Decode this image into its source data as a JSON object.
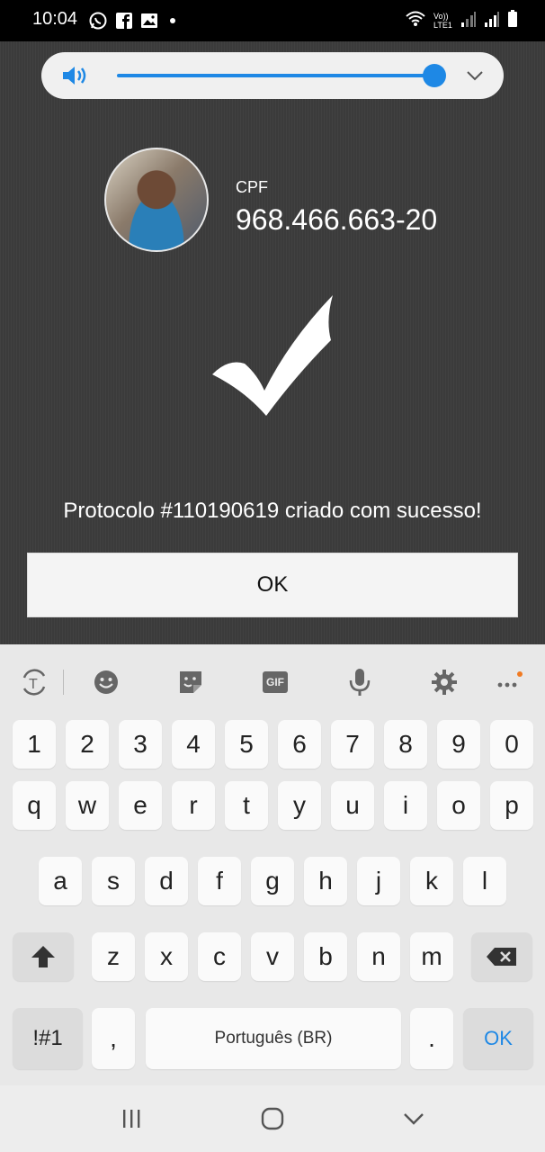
{
  "status_bar": {
    "time": "10:04",
    "icons": [
      "whatsapp-icon",
      "facebook-icon",
      "gallery-icon",
      "dot-icon",
      "wifi-icon",
      "volte-icon",
      "signal-icon",
      "signal-icon",
      "battery-icon"
    ],
    "network_label": "Vo)) LTE1"
  },
  "volume": {
    "level": 1.0,
    "accent": "#1e88e5"
  },
  "profile": {
    "cpf_label": "CPF",
    "cpf_value": "968.466.663-20"
  },
  "result": {
    "message": "Protocolo #110190619 criado com sucesso!",
    "ok_label": "OK"
  },
  "keyboard": {
    "toolbar": [
      "text-recognition-icon",
      "emoji-icon",
      "sticker-icon",
      "gif-icon",
      "microphone-icon",
      "settings-icon",
      "more-icon"
    ],
    "gif_label": "GIF",
    "row1": [
      "1",
      "2",
      "3",
      "4",
      "5",
      "6",
      "7",
      "8",
      "9",
      "0"
    ],
    "row2": [
      "q",
      "w",
      "e",
      "r",
      "t",
      "y",
      "u",
      "i",
      "o",
      "p"
    ],
    "row3": [
      "a",
      "s",
      "d",
      "f",
      "g",
      "h",
      "j",
      "k",
      "l"
    ],
    "row4": [
      "z",
      "x",
      "c",
      "v",
      "b",
      "n",
      "m"
    ],
    "symbols_label": "!#1",
    "comma_label": ",",
    "space_label": "Português (BR)",
    "period_label": ".",
    "enter_label": "OK"
  },
  "nav": [
    "recent-apps-icon",
    "home-icon",
    "back-icon"
  ]
}
